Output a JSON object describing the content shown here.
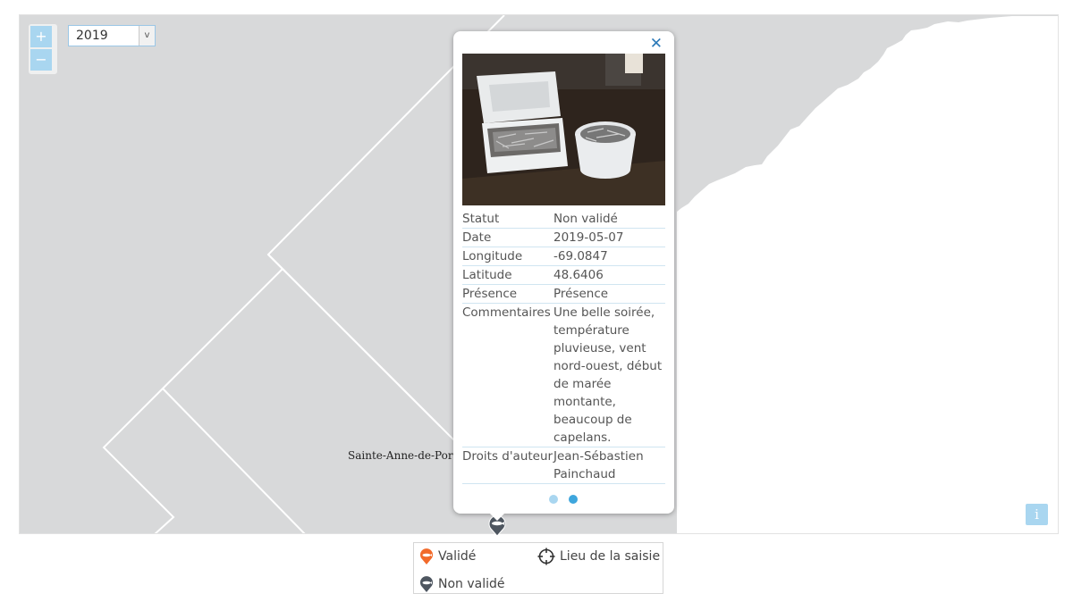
{
  "map": {
    "land_color": "#d8d9da",
    "water_color": "#ffffff",
    "boundary_color": "#ffffff",
    "place_label": "Sainte-Anne-de-Por",
    "info_label": "i",
    "zoom_in_label": "+",
    "zoom_out_label": "−"
  },
  "year_select": {
    "value": "2019",
    "arrow": "v"
  },
  "popup": {
    "close_label": "✕",
    "photo_icon": "cooler-and-bucket-of-capelin-photo",
    "rows": [
      {
        "key": "Statut",
        "value": "Non validé"
      },
      {
        "key": "Date",
        "value": "2019-05-07"
      },
      {
        "key": "Longitude",
        "value": "-69.0847"
      },
      {
        "key": "Latitude",
        "value": "48.6406"
      },
      {
        "key": "Présence",
        "value": "Présence"
      },
      {
        "key": "Commentaires",
        "value": "Une belle soirée, température pluvieuse, vent nord-ouest, début de marée montante, beaucoup de capelans."
      },
      {
        "key": "Droits d'auteur",
        "value": "Jean-Sébastien Painchaud"
      }
    ],
    "dot_colors": [
      "#a9d6f0",
      "#3ea6dd"
    ]
  },
  "marker": {
    "icon": "non-valide-marker-icon",
    "color": "#4e5660"
  },
  "legend": {
    "validated_label": "Validé",
    "validated_color": "#f26a2a",
    "non_validated_label": "Non validé",
    "non_validated_color": "#4e5660",
    "site_label": "Lieu de la saisie",
    "site_icon": "crosshair-icon"
  }
}
